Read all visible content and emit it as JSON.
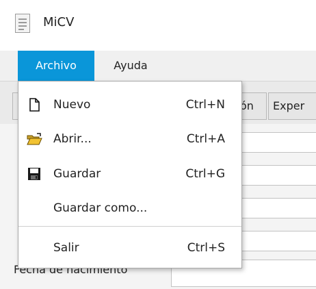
{
  "window": {
    "title": "MiCV",
    "icon": "document-icon"
  },
  "menubar": {
    "items": [
      {
        "label": "Archivo",
        "active": true
      },
      {
        "label": "Ayuda",
        "active": false
      }
    ]
  },
  "tabs": [
    {
      "label": ""
    },
    {
      "label": "ón"
    },
    {
      "label": "Exper"
    }
  ],
  "form": {
    "visible_label": "Fecha de nacimiento"
  },
  "file_menu": {
    "items": [
      {
        "label": "Nuevo",
        "shortcut": "Ctrl+N",
        "icon": "new-file-icon"
      },
      {
        "label": "Abrir...",
        "shortcut": "Ctrl+A",
        "icon": "open-folder-icon"
      },
      {
        "label": "Guardar",
        "shortcut": "Ctrl+G",
        "icon": "save-disk-icon"
      },
      {
        "label": "Guardar como...",
        "shortcut": "",
        "icon": ""
      },
      {
        "label": "Salir",
        "shortcut": "Ctrl+S",
        "icon": ""
      }
    ]
  },
  "colors": {
    "menu_active_bg": "#0a96d9",
    "menu_active_fg": "#ffffff"
  }
}
